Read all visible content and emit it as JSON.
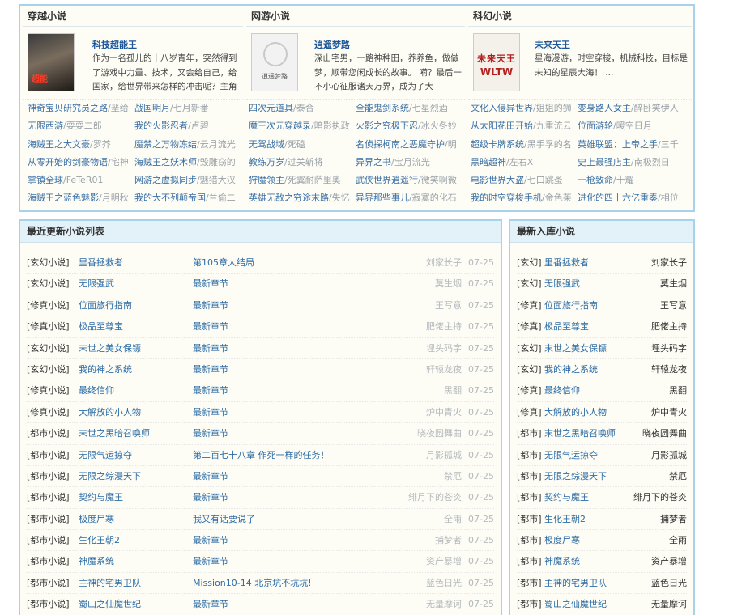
{
  "top": {
    "columns": [
      {
        "title": "穿越小说",
        "feature": {
          "cover_text": "超能",
          "title": "科技超能王",
          "desc": "作为一名孤儿的十八岁青年，突然得到了游戏中力量、技术，又会给自己，给国家，给世界带来怎样的冲击呢？主角虽然"
        },
        "pairs": [
          [
            {
              "b": "神奇宝贝研究员之路",
              "a": "/垩给"
            },
            {
              "b": "战国明月",
              "a": "/七月新番"
            }
          ],
          [
            {
              "b": "无限西游",
              "a": "/耍耍二郎"
            },
            {
              "b": "我的火影忍者",
              "a": "/卢碧"
            }
          ],
          [
            {
              "b": "海贼王之大文豪",
              "a": "/罗芥"
            },
            {
              "b": "魔禁之万物冻结",
              "a": "/云月流光"
            }
          ],
          [
            {
              "b": "从零开始的剑豪物语",
              "a": "/宅神"
            },
            {
              "b": "海贼王之妖术师",
              "a": "/毁雕窃的"
            }
          ],
          [
            {
              "b": "掌镇全球",
              "a": "/FeTeR01"
            },
            {
              "b": "网游之虚拟同步",
              "a": "/魅猎大汉"
            }
          ],
          [
            {
              "b": "海贼王之蓝色魅影",
              "a": "/月明秋"
            },
            {
              "b": "我的大不列颠帝国",
              "a": "/兰偷二"
            }
          ]
        ]
      },
      {
        "title": "网游小说",
        "feature": {
          "cover_text": "逍遥梦路",
          "title": "逍遥梦路",
          "desc": "深山宅男，一路神种田，养养鱼，做做梦，顺带您闲成长的故事。 嗬？最后一不小心征服诸天万界，成为了大BOSS？莫"
        },
        "pairs": [
          [
            {
              "b": "四次元道具",
              "a": "/泰合"
            },
            {
              "b": "全能鬼剑系统",
              "a": "/七星烈酒"
            }
          ],
          [
            {
              "b": "魔王次元穿越录",
              "a": "/暗影执政"
            },
            {
              "b": "火影之究极下忍",
              "a": "/冰火冬妙"
            }
          ],
          [
            {
              "b": "无驾战域",
              "a": "/死磕"
            },
            {
              "b": "名侦探柯南之恶魔守护",
              "a": "/明"
            }
          ],
          [
            {
              "b": "教练万岁",
              "a": "/过关斩将"
            },
            {
              "b": "异界之书",
              "a": "/宝月流光"
            }
          ],
          [
            {
              "b": "狩魔领主",
              "a": "/死翼耐萨里奥"
            },
            {
              "b": "武侠世界逍遥行",
              "a": "/微笑啊微"
            }
          ],
          [
            {
              "b": "英雄无敌之穷途末路",
              "a": "/失忆"
            },
            {
              "b": "异界那些事儿",
              "a": "/寂寞的化石"
            }
          ]
        ]
      },
      {
        "title": "科幻小说",
        "feature": {
          "cover_text": "未来天王",
          "cover_sub": "WLTW",
          "title": "未来天王",
          "desc": "星海漫游，时空穿梭，机械科技，目标是未知的星辰大海！ ..."
        },
        "pairs": [
          [
            {
              "b": "文化入侵异世界",
              "a": "/姐姐的狮"
            },
            {
              "b": "变身路人女主",
              "a": "/醉卧笑伊人"
            }
          ],
          [
            {
              "b": "从太阳花田开始",
              "a": "/九重流云"
            },
            {
              "b": "位面游轮",
              "a": "/暖空日月"
            }
          ],
          [
            {
              "b": "超级卡牌系统",
              "a": "/黑手孚的名"
            },
            {
              "b": "英雄联盟：上帝之手",
              "a": "/三千"
            }
          ],
          [
            {
              "b": "黑暗超神",
              "a": "/左右X"
            },
            {
              "b": "史上最强店主",
              "a": "/南极烈日"
            }
          ],
          [
            {
              "b": "电影世界大盗",
              "a": "/七口跳蚤"
            },
            {
              "b": "一枪致命",
              "a": "/十耀"
            }
          ],
          [
            {
              "b": "我的时空穿梭手机",
              "a": "/金色茱"
            },
            {
              "b": "进化的四十六亿重奏",
              "a": "/相位"
            }
          ]
        ]
      }
    ]
  },
  "recent": {
    "title": "最近更新小说列表",
    "rows": [
      {
        "cat": "[玄幻小说]",
        "name": "里番拯救者",
        "chap": "第105章大结局",
        "author": "刘家长子",
        "date": "07-25"
      },
      {
        "cat": "[玄幻小说]",
        "name": "无限强武",
        "chap": "最新章节",
        "author": "莫生烟",
        "date": "07-25"
      },
      {
        "cat": "[修真小说]",
        "name": "位面旅行指南",
        "chap": "最新章节",
        "author": "王写意",
        "date": "07-25"
      },
      {
        "cat": "[修真小说]",
        "name": "极品至尊宝",
        "chap": "最新章节",
        "author": "肥佬主持",
        "date": "07-25"
      },
      {
        "cat": "[玄幻小说]",
        "name": "末世之美女保镖",
        "chap": "最新章节",
        "author": "埋头码字",
        "date": "07-25"
      },
      {
        "cat": "[玄幻小说]",
        "name": "我的神之系统",
        "chap": "最新章节",
        "author": "轩辕龙夜",
        "date": "07-25"
      },
      {
        "cat": "[修真小说]",
        "name": "最终信仰",
        "chap": "最新章节",
        "author": "黑翻",
        "date": "07-25"
      },
      {
        "cat": "[修真小说]",
        "name": "大解放的小人物",
        "chap": "最新章节",
        "author": "炉中青火",
        "date": "07-25"
      },
      {
        "cat": "[都市小说]",
        "name": "末世之黑暗召唤师",
        "chap": "最新章节",
        "author": "晓夜圆舞曲",
        "date": "07-25"
      },
      {
        "cat": "[都市小说]",
        "name": "无限气运掠夺",
        "chap": "第二百七十八章 作死一样的任务！",
        "author": "月影孤城",
        "date": "07-25"
      },
      {
        "cat": "[都市小说]",
        "name": "无限之综漫天下",
        "chap": "最新章节",
        "author": "禁厄",
        "date": "07-25"
      },
      {
        "cat": "[都市小说]",
        "name": "契约与魔王",
        "chap": "最新章节",
        "author": "绯月下的苍炎",
        "date": "07-25"
      },
      {
        "cat": "[都市小说]",
        "name": "极度尸寒",
        "chap": "我又有话要说了",
        "author": "全雨",
        "date": "07-25"
      },
      {
        "cat": "[都市小说]",
        "name": "生化王朝2",
        "chap": "最新章节",
        "author": "捕梦者",
        "date": "07-25"
      },
      {
        "cat": "[都市小说]",
        "name": "神魔系统",
        "chap": "最新章节",
        "author": "资产暴增",
        "date": "07-25"
      },
      {
        "cat": "[都市小说]",
        "name": "主神的宅男卫队",
        "chap": "Mission10-14 北京坑不坑坑!",
        "author": "蓝色日光",
        "date": "07-25"
      },
      {
        "cat": "[都市小说]",
        "name": "蜀山之仙魔世纪",
        "chap": "最新章节",
        "author": "无量摩诃",
        "date": "07-25"
      }
    ]
  },
  "newest": {
    "title": "最新入库小说",
    "rows": [
      {
        "cat": "[玄幻]",
        "name": "里番拯救者",
        "author": "刘家长子"
      },
      {
        "cat": "[玄幻]",
        "name": "无限强武",
        "author": "莫生烟"
      },
      {
        "cat": "[修真]",
        "name": "位面旅行指南",
        "author": "王写意"
      },
      {
        "cat": "[修真]",
        "name": "极品至尊宝",
        "author": "肥佬主持"
      },
      {
        "cat": "[玄幻]",
        "name": "末世之美女保镖",
        "author": "埋头码字"
      },
      {
        "cat": "[玄幻]",
        "name": "我的神之系统",
        "author": "轩辕龙夜"
      },
      {
        "cat": "[修真]",
        "name": "最终信仰",
        "author": "黑翻"
      },
      {
        "cat": "[修真]",
        "name": "大解放的小人物",
        "author": "炉中青火"
      },
      {
        "cat": "[都市]",
        "name": "末世之黑暗召唤师",
        "author": "晓夜圆舞曲"
      },
      {
        "cat": "[都市]",
        "name": "无限气运掠夺",
        "author": "月影孤城"
      },
      {
        "cat": "[都市]",
        "name": "无限之综漫天下",
        "author": "禁厄"
      },
      {
        "cat": "[都市]",
        "name": "契约与魔王",
        "author": "绯月下的苍炎"
      },
      {
        "cat": "[都市]",
        "name": "生化王朝2",
        "author": "捕梦者"
      },
      {
        "cat": "[都市]",
        "name": "极度尸寒",
        "author": "全雨"
      },
      {
        "cat": "[都市]",
        "name": "神魔系统",
        "author": "资产暴增"
      },
      {
        "cat": "[都市]",
        "name": "主神的宅男卫队",
        "author": "蓝色日光"
      },
      {
        "cat": "[都市]",
        "name": "蜀山之仙魔世纪",
        "author": "无量摩诃"
      }
    ]
  }
}
